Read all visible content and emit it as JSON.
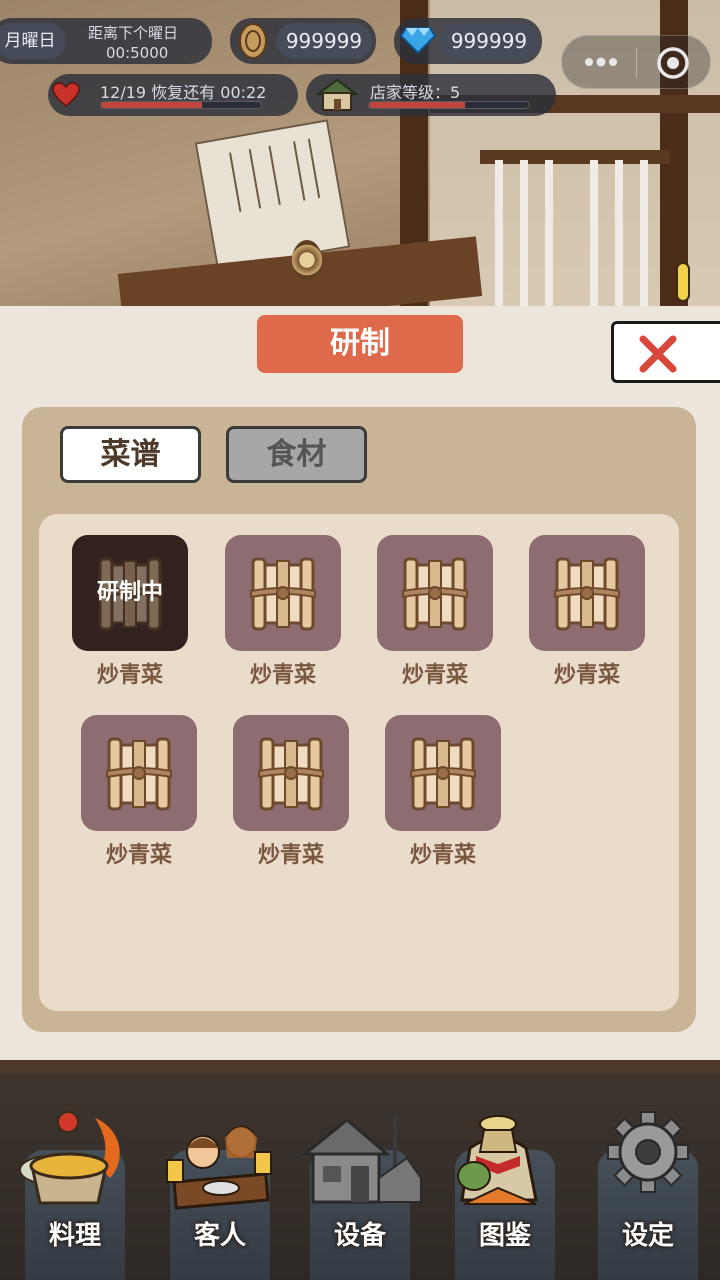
{
  "hud": {
    "weekday": "月曜日",
    "next_day_label": "距离下个曜日",
    "next_day_timer": "00:5000",
    "coins": "999999",
    "gems": "999999",
    "stamina_text": "12/19 恢复还有 00:22",
    "stamina_fraction": 0.63,
    "shop_level_text": "店家等级：5",
    "shop_level_fraction": 0.6,
    "menu_icon": "more-dots-icon",
    "target_icon": "target-circle-icon"
  },
  "dialog": {
    "title": "研制",
    "tabs": [
      {
        "label": "菜谱",
        "selected": true
      },
      {
        "label": "食材",
        "selected": false
      }
    ],
    "items": [
      {
        "label": "炒青菜",
        "status": "研制中"
      },
      {
        "label": "炒青菜",
        "status": ""
      },
      {
        "label": "炒青菜",
        "status": ""
      },
      {
        "label": "炒青菜",
        "status": ""
      },
      {
        "label": "炒青菜",
        "status": ""
      },
      {
        "label": "炒青菜",
        "status": ""
      },
      {
        "label": "炒青菜",
        "status": ""
      }
    ]
  },
  "nav": [
    {
      "label": "料理",
      "icon": "cooking-pot-icon"
    },
    {
      "label": "客人",
      "icon": "customers-icon"
    },
    {
      "label": "设备",
      "icon": "shop-building-icon"
    },
    {
      "label": "图鉴",
      "icon": "collection-bag-icon"
    },
    {
      "label": "设定",
      "icon": "gear-icon"
    }
  ],
  "colors": {
    "accent": "#df6a4b",
    "tile": "#8e6d72",
    "panel": "#c9b495",
    "close_x": "#d9473a"
  }
}
